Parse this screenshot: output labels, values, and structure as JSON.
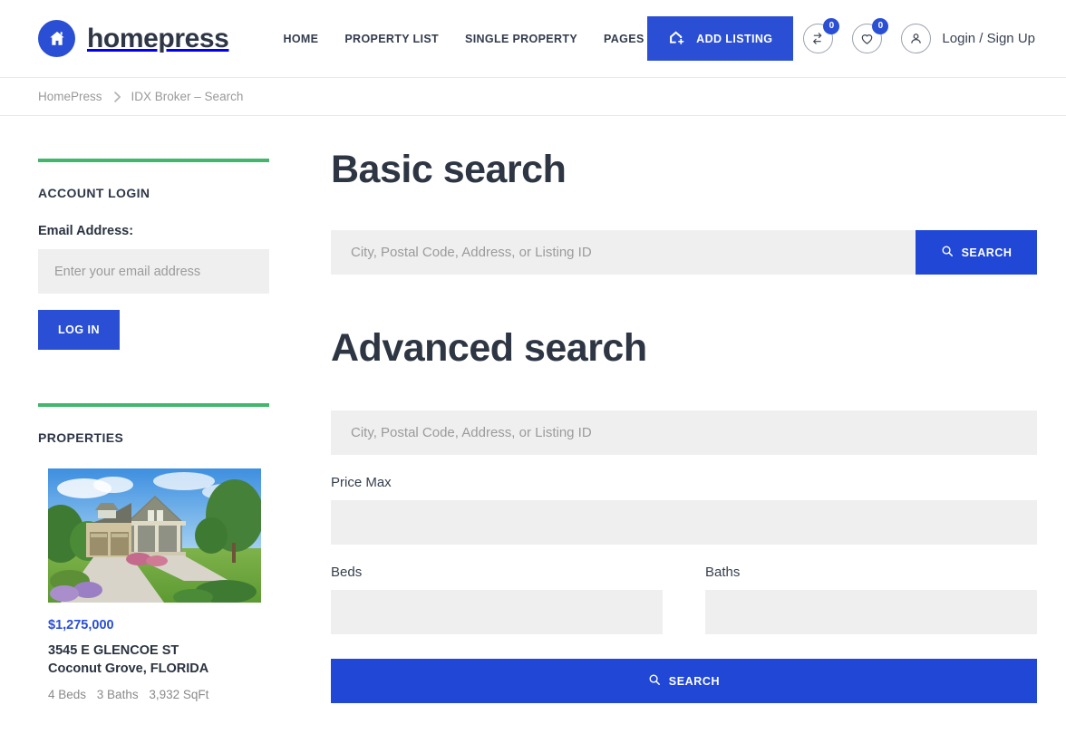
{
  "brand": {
    "name": "homepress",
    "logo_icon": "house-icon",
    "accent_blue": "#2a4fd4",
    "accent_green": "#42b76c"
  },
  "header": {
    "nav": [
      {
        "label": "HOME",
        "name": "home"
      },
      {
        "label": "PROPERTY LIST",
        "name": "property-list"
      },
      {
        "label": "SINGLE PROPERTY",
        "name": "single-property"
      },
      {
        "label": "PAGES",
        "name": "pages"
      }
    ],
    "add_listing": {
      "label": "ADD LISTING",
      "icon": "house-plus-icon"
    },
    "compare": {
      "icon": "compare-arrows-icon",
      "count": "0"
    },
    "favorites": {
      "icon": "heart-icon",
      "count": "0"
    },
    "account": {
      "icon": "user-icon",
      "label": "Login / Sign Up"
    }
  },
  "breadcrumb": {
    "home": "HomePress",
    "separator_icon": "chevron-right-icon",
    "current": "IDX Broker – Search"
  },
  "sidebar": {
    "account_login": {
      "title": "ACCOUNT LOGIN",
      "email_label": "Email Address:",
      "email_placeholder": "Enter your email address",
      "email_value": "",
      "login_button": "LOG IN"
    },
    "properties": {
      "title": "PROPERTIES",
      "items": [
        {
          "price": "$1,275,000",
          "address_line1": "3545 E GLENCOE ST",
          "address_line2": "Coconut Grove, FLORIDA",
          "beds": "4 Beds",
          "baths": "3 Baths",
          "sqft": "3,932 SqFt",
          "image_alt": "two-story-craftsman-house-with-lawn"
        }
      ]
    }
  },
  "main": {
    "basic_search": {
      "title": "Basic search",
      "input_placeholder": "City, Postal Code, Address, or Listing ID",
      "input_value": "",
      "search_button": "SEARCH",
      "search_icon": "search-icon"
    },
    "advanced_search": {
      "title": "Advanced search",
      "input_placeholder": "City, Postal Code, Address, or Listing ID",
      "input_value": "",
      "price_max_label": "Price Max",
      "price_max_value": "",
      "beds_label": "Beds",
      "beds_value": "",
      "baths_label": "Baths",
      "baths_value": "",
      "search_button": "SEARCH",
      "search_icon": "search-icon"
    }
  }
}
